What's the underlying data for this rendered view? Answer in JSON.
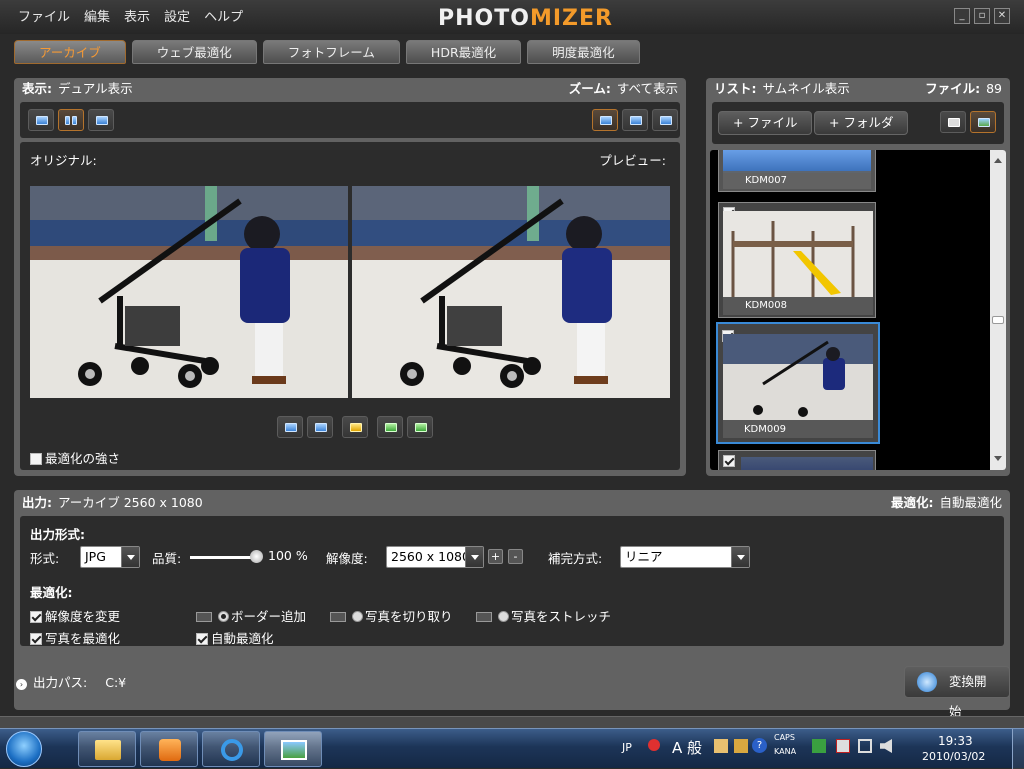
{
  "menu": [
    "ファイル",
    "編集",
    "表示",
    "設定",
    "ヘルプ"
  ],
  "logo": {
    "part1": "PHOTO",
    "part2": "MIZER"
  },
  "window_buttons": {
    "min": "_",
    "max": "▫",
    "close": "✕"
  },
  "tabs": [
    "アーカイブ",
    "ウェブ最適化",
    "フォトフレーム",
    "HDR最適化",
    "明度最適化"
  ],
  "view_panel": {
    "display_label": "表示:",
    "display_value": "デュアル表示",
    "zoom_label": "ズーム:",
    "zoom_value": "すべて表示",
    "original_label": "オリジナル:",
    "preview_label": "プレビュー:",
    "strength_label": "最適化の強さ"
  },
  "list_panel": {
    "list_label": "リスト:",
    "list_value": "サムネイル表示",
    "files_label": "ファイル:",
    "files_count": "89",
    "add_file": "+ ファイル",
    "add_folder": "+ フォルダ",
    "thumbnails": [
      "KDM007",
      "KDM008",
      "KDM009"
    ]
  },
  "output_panel": {
    "output_label": "出力:",
    "output_value": "アーカイブ  2560 x 1080",
    "optimize_label": "最適化:",
    "optimize_value": "自動最適化",
    "format_section": "出力形式:",
    "format_label": "形式:",
    "format_value": "JPG",
    "quality_label": "品質:",
    "quality_value": "100 %",
    "quality_level": 1.0,
    "resolution_label": "解像度:",
    "resolution_value": "2560 x 1080",
    "interp_label": "補完方式:",
    "interp_value": "リニア",
    "plus": "+",
    "minus": "-",
    "optimize_section": "最適化:",
    "opt_change_res": "解像度を変更",
    "opt_photo": "写真を最適化",
    "opt_border": "ボーダー追加",
    "opt_crop": "写真を切り取り",
    "opt_stretch": "写真をストレッチ",
    "opt_auto": "自動最適化"
  },
  "footer": {
    "path_label": "出力パス:",
    "path_value": "C:¥",
    "start_button": "変換開始"
  },
  "taskbar": {
    "lang": "JP",
    "ime": "A 般",
    "caps": "CAPS",
    "kana": "KANA",
    "time": "19:33",
    "date": "2010/03/02"
  }
}
